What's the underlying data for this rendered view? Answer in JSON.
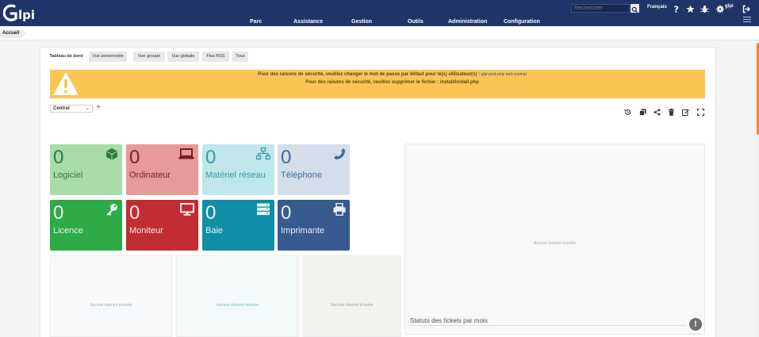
{
  "app": {
    "logo_text": "Glpi"
  },
  "header": {
    "search_placeholder": "Rechercher",
    "language": "Français",
    "user": "glpi"
  },
  "menu": {
    "items": [
      "Parc",
      "Assistance",
      "Gestion",
      "Outils",
      "Administration",
      "Configuration"
    ]
  },
  "breadcrumb": {
    "label": "Accueil"
  },
  "tabs": [
    "Tableau de bord",
    "Vue personnelle",
    "Vue groupe",
    "Vue globale",
    "Flux RSS",
    "Tous"
  ],
  "alert": {
    "line1": "Pour des raisons de sécurité, veuillez changer le mot de passe par défaut pour le(s) utilisateur(s) :",
    "line1_users": "glpi post-only tech normal",
    "line2": "Pour des raisons de sécurité, veuillez supprimer le fichier : install/install.php"
  },
  "dashboard": {
    "selected": "Central",
    "add_label": "+"
  },
  "cards": [
    {
      "value": "0",
      "label": "Logiciel",
      "icon": "cube-icon",
      "bg": "#a8dca8",
      "fg": "#2f7a3a"
    },
    {
      "value": "0",
      "label": "Ordinateur",
      "icon": "laptop-icon",
      "bg": "#e89a9a",
      "fg": "#7a1f1f"
    },
    {
      "value": "0",
      "label": "Matériel réseau",
      "icon": "network-icon",
      "bg": "#bfe6ea",
      "fg": "#3a9aa6"
    },
    {
      "value": "0",
      "label": "Téléphone",
      "icon": "phone-icon",
      "bg": "#d4deea",
      "fg": "#3f6a9a"
    },
    {
      "value": "0",
      "label": "Licence",
      "icon": "key-icon",
      "bg": "#2eaa46",
      "fg": "#e9f7ec"
    },
    {
      "value": "0",
      "label": "Moniteur",
      "icon": "monitor-icon",
      "bg": "#c12d31",
      "fg": "#fbe9e9"
    },
    {
      "value": "0",
      "label": "Baie",
      "icon": "rack-icon",
      "bg": "#0f8ea5",
      "fg": "#e5f6f9"
    },
    {
      "value": "0",
      "label": "Imprimante",
      "icon": "printer-icon",
      "bg": "#375a8f",
      "fg": "#e8eef7"
    }
  ],
  "empty_text": "Aucune donnée trouvée",
  "tickets_status": {
    "title": "Statuts des tickets par mois"
  }
}
